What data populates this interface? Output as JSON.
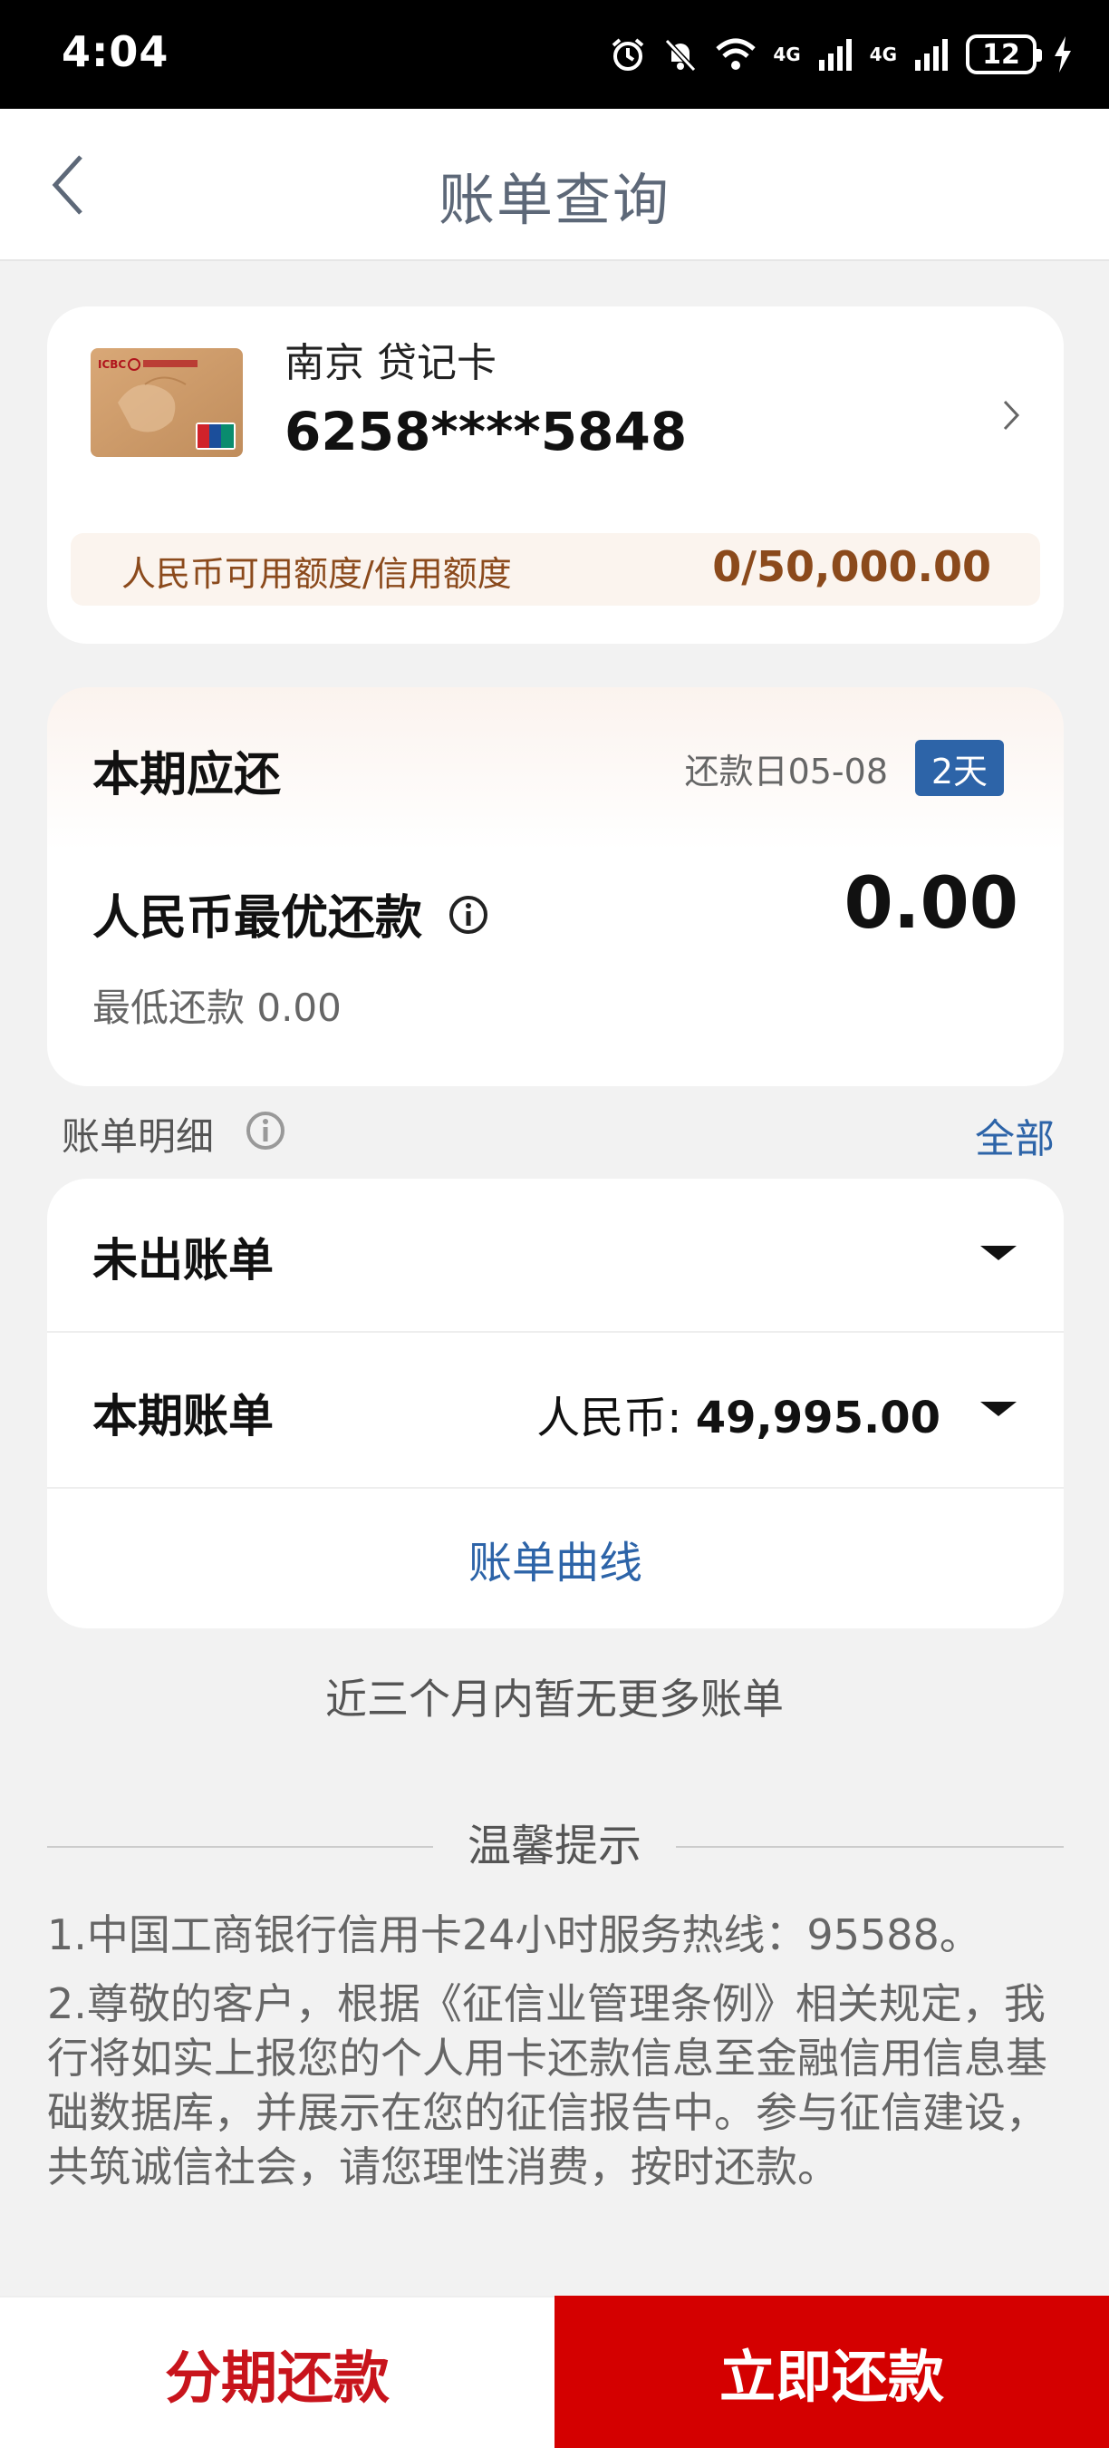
{
  "status_bar": {
    "time": "4:04",
    "network_1": "4G",
    "network_2": "4G",
    "battery": "12"
  },
  "header": {
    "title": "账单查询"
  },
  "card": {
    "type": "南京 贷记卡",
    "number": "6258****5848",
    "credit_label": "人民币可用额度/信用额度",
    "credit_value": "0/50,000.00"
  },
  "repayment": {
    "title": "本期应还",
    "due_date": "还款日05-08",
    "days_badge": "2天",
    "best_label": "人民币最优还款",
    "best_value": "0.00",
    "min_label": "最低还款 0.00"
  },
  "bill_detail": {
    "label": "账单明细",
    "all_link": "全部",
    "rows": [
      {
        "label": "未出账单",
        "currency": "",
        "amount": ""
      },
      {
        "label": "本期账单",
        "currency": "人民币: ",
        "amount": "49,995.00"
      }
    ],
    "curve_link": "账单曲线",
    "no_more": "近三个月内暂无更多账单"
  },
  "tips": {
    "title": "温馨提示",
    "items": [
      "1.中国工商银行信用卡24小时服务热线：95588。",
      "2.尊敬的客户，根据《征信业管理条例》相关规定，我行将如实上报您的个人用卡还款信息至金融信用信息基础数据库，并展示在您的征信报告中。参与征信建设，共筑诚信社会，请您理性消费，按时还款。"
    ]
  },
  "actions": {
    "installment": "分期还款",
    "pay_now": "立即还款"
  },
  "colors": {
    "accent_blue": "#2d64a8",
    "brand_red": "#d40000",
    "credit_brown": "#8b4a1c"
  }
}
